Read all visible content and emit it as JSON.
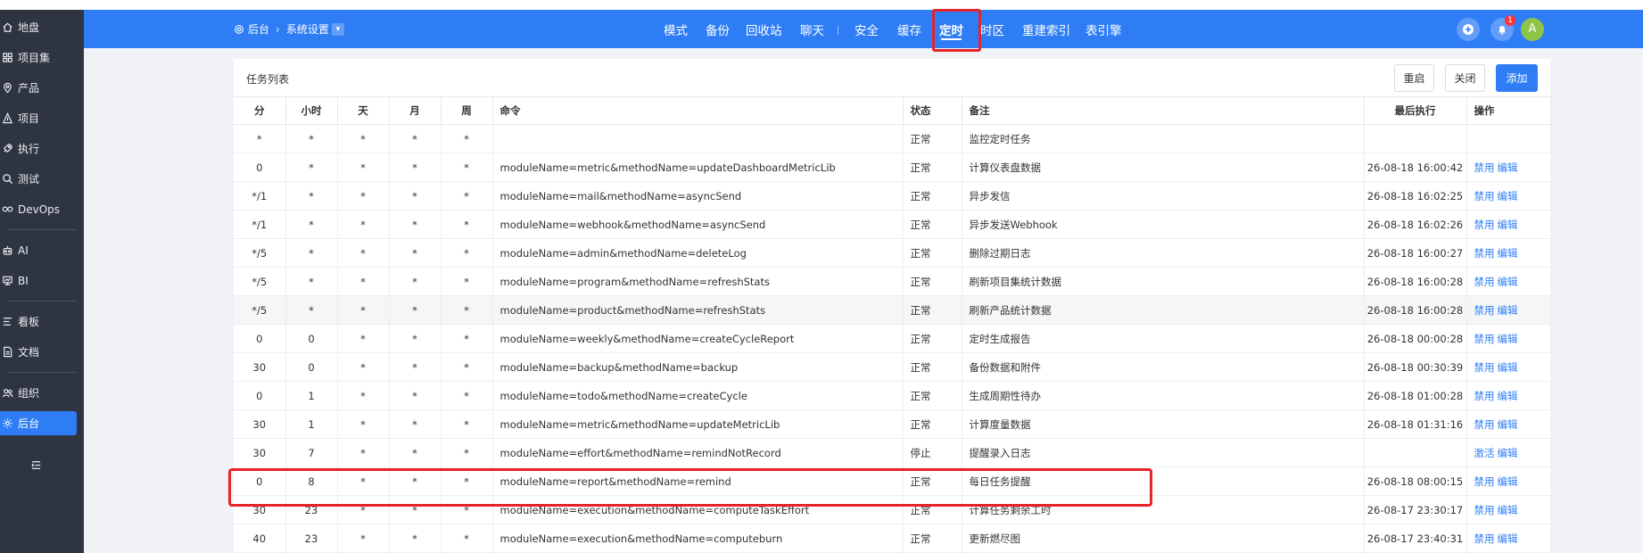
{
  "sidebar": {
    "items": [
      {
        "label": "地盘",
        "icon": "home-icon"
      },
      {
        "label": "项目集",
        "icon": "grid-icon"
      },
      {
        "label": "产品",
        "icon": "location-pin-icon"
      },
      {
        "label": "项目",
        "icon": "project-icon"
      },
      {
        "label": "执行",
        "icon": "rocket-icon"
      },
      {
        "label": "测试",
        "icon": "search-icon"
      },
      {
        "label": "DevOps",
        "icon": "infinity-icon"
      },
      {
        "label": "AI",
        "icon": "robot-icon"
      },
      {
        "label": "BI",
        "icon": "chart-icon"
      },
      {
        "label": "看板",
        "icon": "kanban-icon"
      },
      {
        "label": "文档",
        "icon": "document-icon"
      },
      {
        "label": "组织",
        "icon": "people-icon"
      },
      {
        "label": "后台",
        "icon": "gear-icon"
      }
    ],
    "active": "后台"
  },
  "breadcrumb": {
    "root": "后台",
    "current": "系统设置"
  },
  "nav": {
    "tabs": [
      "模式",
      "备份",
      "回收站",
      "聊天",
      "安全",
      "缓存",
      "定时",
      "时区",
      "重建索引",
      "表引擎"
    ],
    "active": "定时"
  },
  "notifications": {
    "count": "1"
  },
  "user": {
    "initial": "A"
  },
  "panel": {
    "title": "任务列表",
    "buttons": {
      "restart": "重启",
      "close": "关闭",
      "add": "添加"
    }
  },
  "table": {
    "headers": [
      "分",
      "小时",
      "天",
      "月",
      "周",
      "命令",
      "状态",
      "备注",
      "最后执行",
      "操作"
    ],
    "rows": [
      {
        "min": "*",
        "hour": "*",
        "day": "*",
        "month": "*",
        "week": "*",
        "command": "",
        "status": "正常",
        "remark": "监控定时任务",
        "last": "",
        "actions": []
      },
      {
        "min": "0",
        "hour": "*",
        "day": "*",
        "month": "*",
        "week": "*",
        "command": "moduleName=metric&methodName=updateDashboardMetricLib",
        "status": "正常",
        "remark": "计算仪表盘数据",
        "last": "26-08-18 16:00:42",
        "actions": [
          "禁用",
          "编辑"
        ]
      },
      {
        "min": "*/1",
        "hour": "*",
        "day": "*",
        "month": "*",
        "week": "*",
        "command": "moduleName=mail&methodName=asyncSend",
        "status": "正常",
        "remark": "异步发信",
        "last": "26-08-18 16:02:25",
        "actions": [
          "禁用",
          "编辑"
        ]
      },
      {
        "min": "*/1",
        "hour": "*",
        "day": "*",
        "month": "*",
        "week": "*",
        "command": "moduleName=webhook&methodName=asyncSend",
        "status": "正常",
        "remark": "异步发送Webhook",
        "last": "26-08-18 16:02:26",
        "actions": [
          "禁用",
          "编辑"
        ]
      },
      {
        "min": "*/5",
        "hour": "*",
        "day": "*",
        "month": "*",
        "week": "*",
        "command": "moduleName=admin&methodName=deleteLog",
        "status": "正常",
        "remark": "删除过期日志",
        "last": "26-08-18 16:00:27",
        "actions": [
          "禁用",
          "编辑"
        ]
      },
      {
        "min": "*/5",
        "hour": "*",
        "day": "*",
        "month": "*",
        "week": "*",
        "command": "moduleName=program&methodName=refreshStats",
        "status": "正常",
        "remark": "刷新项目集统计数据",
        "last": "26-08-18 16:00:28",
        "actions": [
          "禁用",
          "编辑"
        ]
      },
      {
        "min": "*/5",
        "hour": "*",
        "day": "*",
        "month": "*",
        "week": "*",
        "command": "moduleName=product&methodName=refreshStats",
        "status": "正常",
        "remark": "刷新产品统计数据",
        "last": "26-08-18 16:00:28",
        "actions": [
          "禁用",
          "编辑"
        ]
      },
      {
        "min": "0",
        "hour": "0",
        "day": "*",
        "month": "*",
        "week": "*",
        "command": "moduleName=weekly&methodName=createCycleReport",
        "status": "正常",
        "remark": "定时生成报告",
        "last": "26-08-18 00:00:28",
        "actions": [
          "禁用",
          "编辑"
        ]
      },
      {
        "min": "30",
        "hour": "0",
        "day": "*",
        "month": "*",
        "week": "*",
        "command": "moduleName=backup&methodName=backup",
        "status": "正常",
        "remark": "备份数据和附件",
        "last": "26-08-18 00:30:39",
        "actions": [
          "禁用",
          "编辑"
        ]
      },
      {
        "min": "0",
        "hour": "1",
        "day": "*",
        "month": "*",
        "week": "*",
        "command": "moduleName=todo&methodName=createCycle",
        "status": "正常",
        "remark": "生成周期性待办",
        "last": "26-08-18 01:00:28",
        "actions": [
          "禁用",
          "编辑"
        ]
      },
      {
        "min": "30",
        "hour": "1",
        "day": "*",
        "month": "*",
        "week": "*",
        "command": "moduleName=metric&methodName=updateMetricLib",
        "status": "正常",
        "remark": "计算度量数据",
        "last": "26-08-18 01:31:16",
        "actions": [
          "禁用",
          "编辑"
        ]
      },
      {
        "min": "30",
        "hour": "7",
        "day": "*",
        "month": "*",
        "week": "*",
        "command": "moduleName=effort&methodName=remindNotRecord",
        "status": "停止",
        "remark": "提醒录入日志",
        "last": "",
        "actions": [
          "激活",
          "编辑"
        ]
      },
      {
        "min": "0",
        "hour": "8",
        "day": "*",
        "month": "*",
        "week": "*",
        "command": "moduleName=report&methodName=remind",
        "status": "正常",
        "remark": "每日任务提醒",
        "last": "26-08-18 08:00:15",
        "actions": [
          "禁用",
          "编辑"
        ]
      },
      {
        "min": "30",
        "hour": "23",
        "day": "*",
        "month": "*",
        "week": "*",
        "command": "moduleName=execution&methodName=computeTaskEffort",
        "status": "正常",
        "remark": "计算任务剩余工时",
        "last": "26-08-17 23:30:17",
        "actions": [
          "禁用",
          "编辑"
        ]
      },
      {
        "min": "40",
        "hour": "23",
        "day": "*",
        "month": "*",
        "week": "*",
        "command": "moduleName=execution&methodName=computeburn",
        "status": "正常",
        "remark": "更新燃尽图",
        "last": "26-08-17 23:40:31",
        "actions": [
          "禁用",
          "编辑"
        ]
      }
    ]
  },
  "colors": {
    "primary": "#2e7df5",
    "sidebar": "#2e3440",
    "highlight": "#e8222a"
  }
}
